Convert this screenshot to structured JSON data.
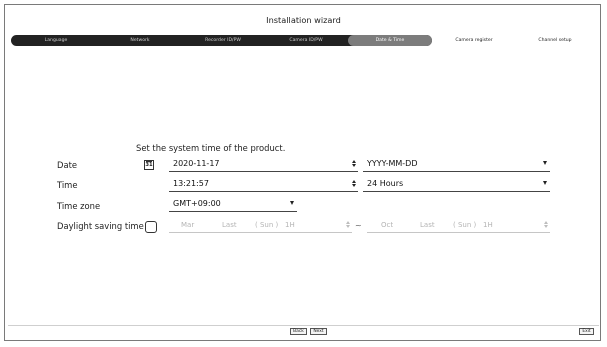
{
  "wizard": {
    "title": "Installation wizard",
    "steps": [
      "Language",
      "Network",
      "Recorder ID/PW",
      "Camera ID/PW",
      "Date & Time",
      "Camera register",
      "Channel setup"
    ],
    "active_step": "Date & Time"
  },
  "form": {
    "heading": "Set the system time of the product.",
    "date": {
      "label": "Date",
      "calendar_icon_text": "31",
      "value": "2020-11-17",
      "format": "YYYY-MM-DD"
    },
    "time": {
      "label": "Time",
      "value": "13:21:57",
      "format": "24 Hours"
    },
    "timezone": {
      "label": "Time zone",
      "value": "GMT+09:00"
    },
    "dst": {
      "label": "Daylight saving time",
      "checked": false,
      "start": {
        "month": "Mar",
        "week": "Last",
        "day": "( Sun )",
        "hour": "1H"
      },
      "separator": "~",
      "end": {
        "month": "Oct",
        "week": "Last",
        "day": "( Sun )",
        "hour": "1H"
      }
    }
  },
  "footer": {
    "back": "Back",
    "next": "Next",
    "exit": "Exit"
  }
}
